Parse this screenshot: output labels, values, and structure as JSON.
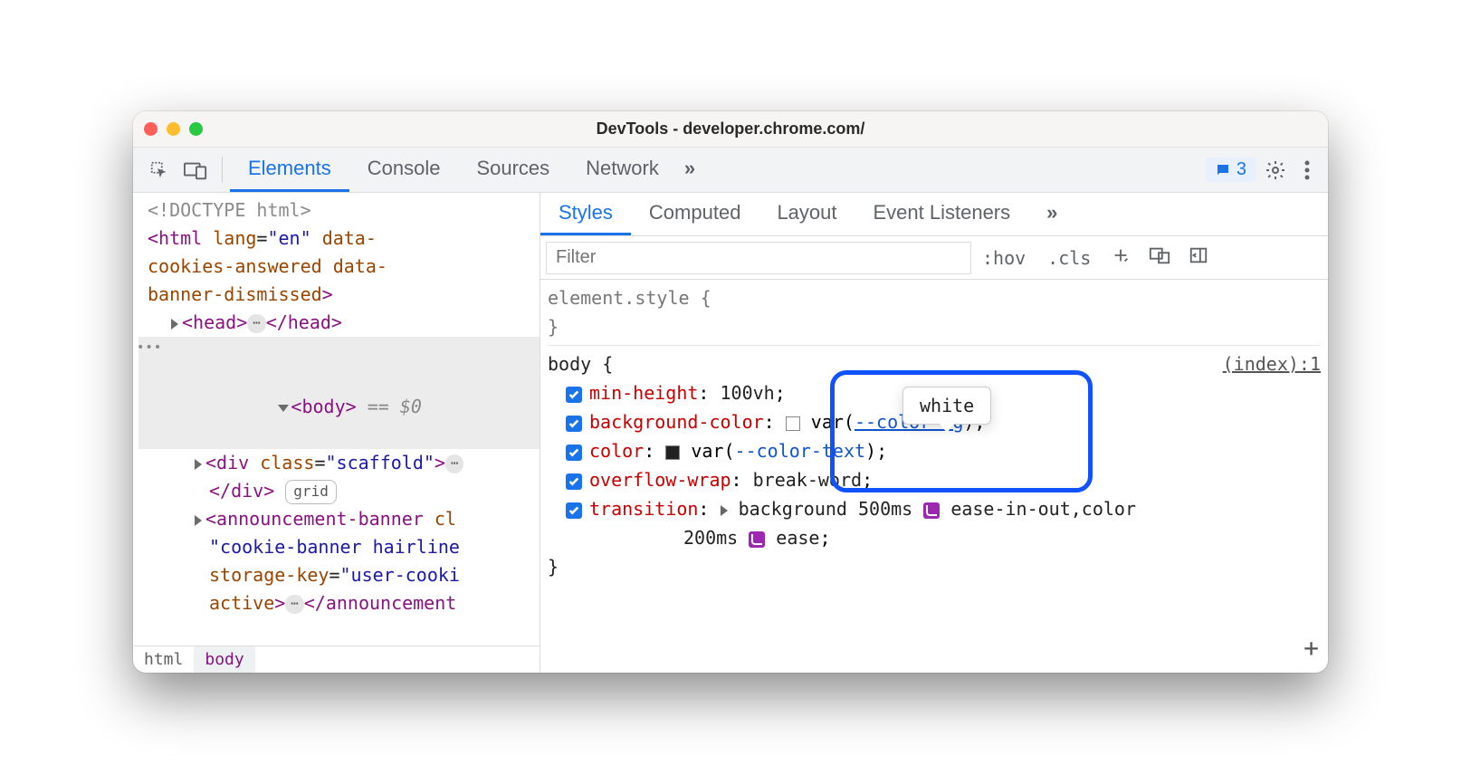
{
  "titlebar": {
    "title": "DevTools - developer.chrome.com/"
  },
  "toolbar": {
    "tabs": [
      "Elements",
      "Console",
      "Sources",
      "Network"
    ],
    "active_tab": 0,
    "more_glyph": "»",
    "issues_count": "3"
  },
  "dom": {
    "doctype": "<!DOCTYPE html>",
    "html_open": {
      "tag": "html",
      "attrs": "lang=\"en\" data-cookies-answered data-banner-dismissed"
    },
    "head": {
      "open": "<head>",
      "close": "</head>"
    },
    "body": {
      "open": "<body>",
      "eq": "== $0"
    },
    "scaffold": {
      "open": "<div class=\"scaffold\">",
      "close": "</div>",
      "badge": "grid"
    },
    "announce": {
      "tag_open": "<announcement-banner cl",
      "attr_lines": "\"cookie-banner hairline\nstorage-key=\"user-cooki\nactive>",
      "close": "</announcement"
    }
  },
  "breadcrumb": [
    "html",
    "body"
  ],
  "styles": {
    "subtabs": [
      "Styles",
      "Computed",
      "Layout",
      "Event Listeners"
    ],
    "active_subtab": 0,
    "more_glyph": "»",
    "filter_placeholder": "Filter",
    "hov_label": ":hov",
    "cls_label": ".cls",
    "element_style": {
      "selector": "element.style {",
      "close": "}"
    },
    "body_rule": {
      "selector": "body {",
      "source": "(index):1",
      "props": [
        {
          "name": "min-height",
          "value": "100vh"
        },
        {
          "name": "background-color",
          "swatch": "white",
          "var": "--color-bg"
        },
        {
          "name": "color",
          "swatch": "black",
          "var": "--color-text"
        },
        {
          "name": "overflow-wrap",
          "value": "break-word"
        },
        {
          "name": "transition",
          "value_parts": {
            "p1": "background 500ms ",
            "ease1": "ease-in-out",
            "mid": ",color",
            "p2": "200ms ",
            "ease2": "ease"
          }
        }
      ],
      "close": "}"
    },
    "tooltip": "white"
  }
}
